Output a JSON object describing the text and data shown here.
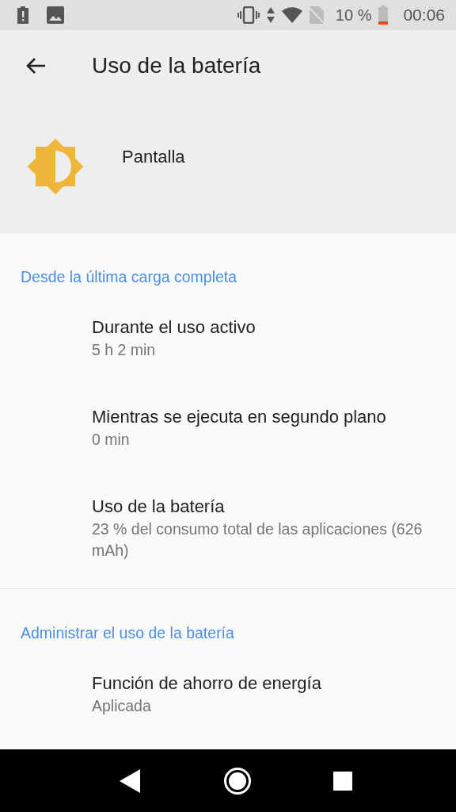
{
  "status_bar": {
    "battery_percent": "10 %",
    "time": "00:06"
  },
  "toolbar": {
    "title": "Uso de la batería"
  },
  "app": {
    "name": "Pantalla"
  },
  "sections": [
    {
      "header": "Desde la última carga completa",
      "items": [
        {
          "title": "Durante el uso activo",
          "summary": "5 h 2 min"
        },
        {
          "title": "Mientras se ejecuta en segundo plano",
          "summary": "0 min"
        },
        {
          "title": "Uso de la batería",
          "summary": "23 % del consumo total de las aplicaciones (626 mAh)"
        }
      ]
    },
    {
      "header": "Administrar el uso de la batería",
      "items": [
        {
          "title": "Función de ahorro de energía",
          "summary": "Aplicada"
        }
      ]
    }
  ]
}
